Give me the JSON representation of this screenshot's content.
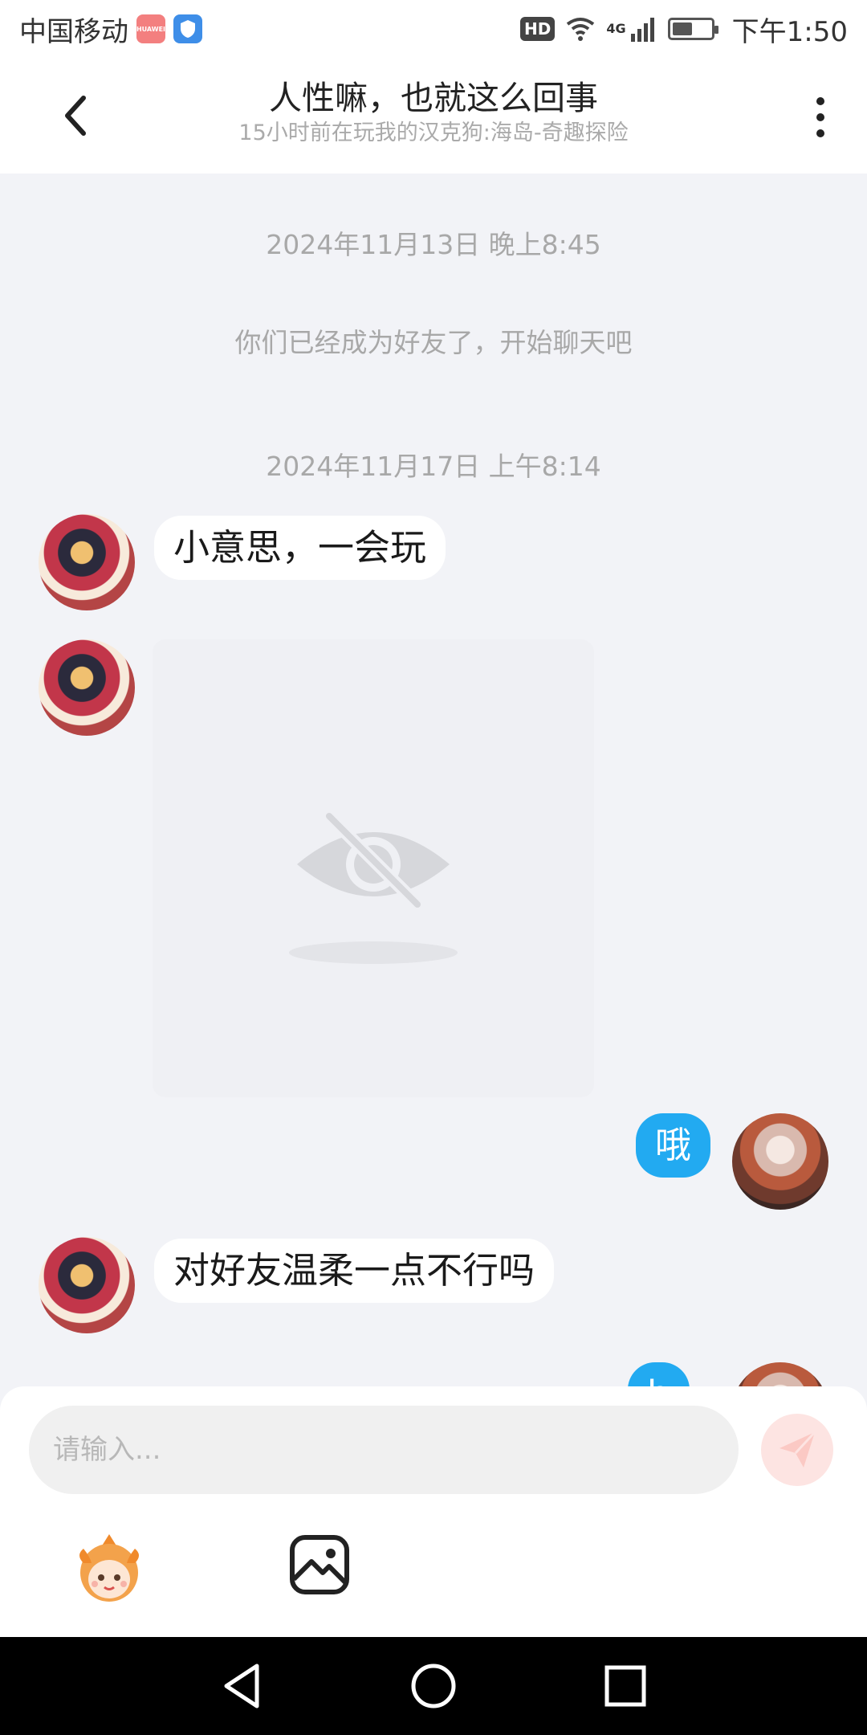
{
  "status_bar": {
    "carrier": "中国移动",
    "hd": "HD",
    "network": "4G",
    "time": "下午1:50"
  },
  "header": {
    "title": "人性嘛，也就这么回事",
    "subtitle": "15小时前在玩我的汉克狗:海岛-奇趣探险"
  },
  "messages": {
    "ts1": "2024年11月13日 晚上8:45",
    "system": "你们已经成为好友了，开始聊天吧",
    "ts2": "2024年11月17日 上午8:14",
    "msg1": "小意思，一会玩",
    "msg2": "哦",
    "msg3": "对好友温柔一点不行吗",
    "msg4_partial": "h"
  },
  "composer": {
    "placeholder": "请输入..."
  },
  "colors": {
    "accent": "#22aaf1",
    "send_disabled": "#fde4e2",
    "background": "#f2f3f7"
  },
  "icons": {
    "back": "back-arrow-icon",
    "more": "more-vertical-icon",
    "send": "send-icon",
    "emoji": "mascot-emoji-icon",
    "image": "image-icon",
    "hidden_image": "eye-off-icon"
  }
}
